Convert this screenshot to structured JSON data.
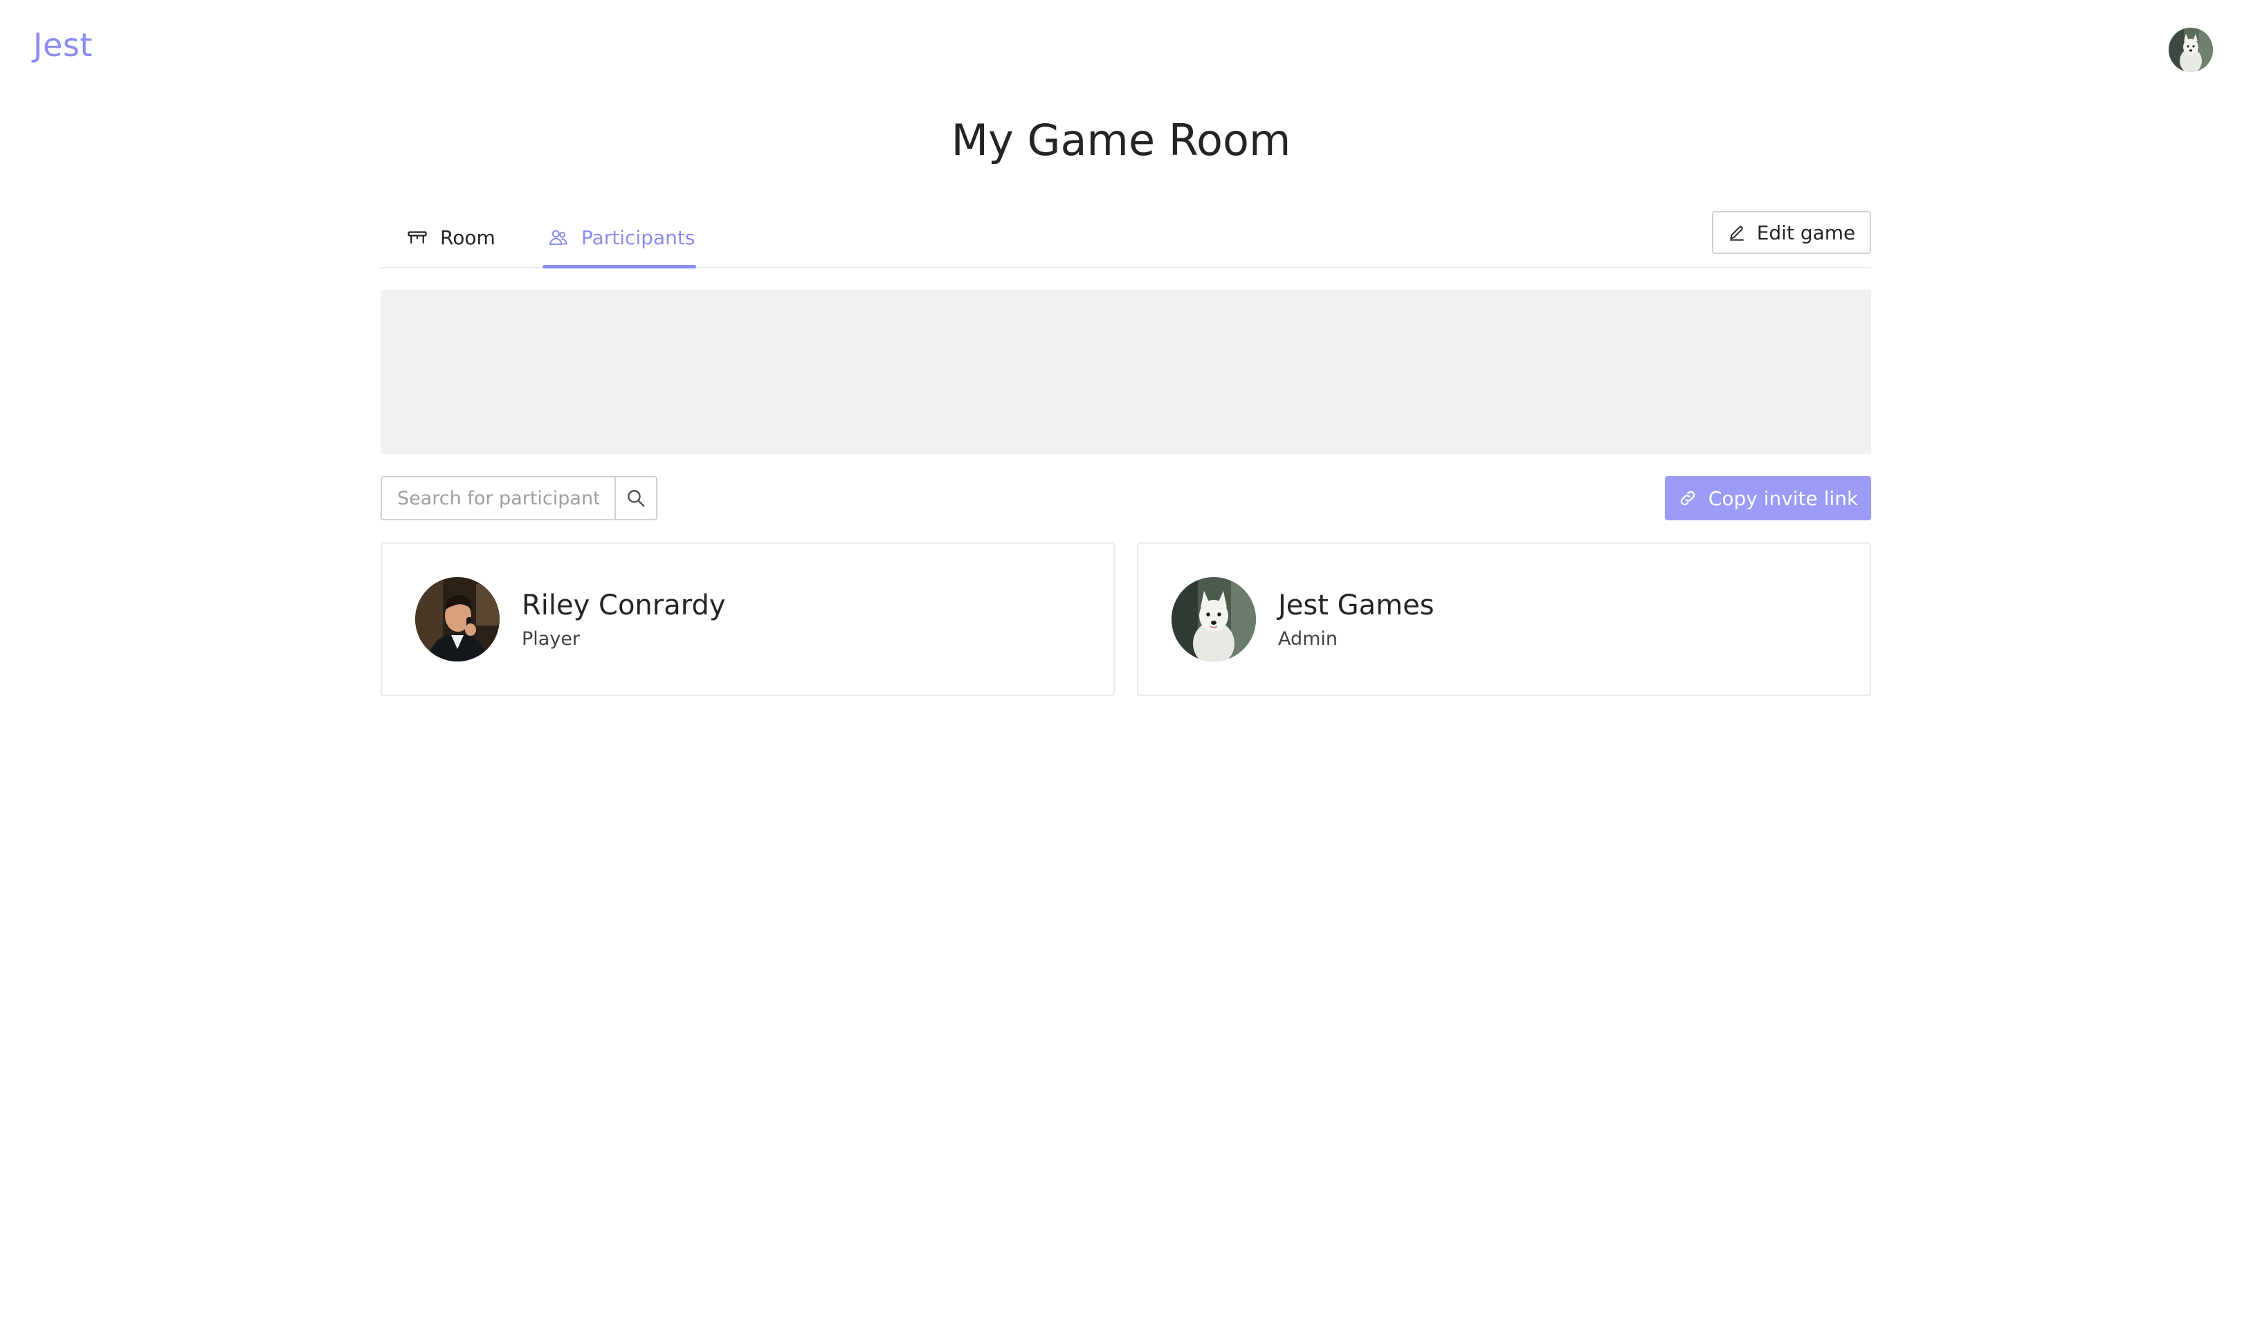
{
  "app": {
    "logo": "Jest"
  },
  "header": {
    "title": "My Game Room"
  },
  "tabs": [
    {
      "label": "Room",
      "icon": "table-icon",
      "active": false
    },
    {
      "label": "Participants",
      "icon": "people-icon",
      "active": true
    }
  ],
  "actions": {
    "edit_label": "Edit game",
    "copy_invite_label": "Copy invite link"
  },
  "search": {
    "placeholder": "Search for participant",
    "value": ""
  },
  "participants": [
    {
      "name": "Riley Conrardy",
      "role": "Player",
      "avatar": "man-phone-avatar"
    },
    {
      "name": "Jest Games",
      "role": "Admin",
      "avatar": "white-dog-avatar"
    }
  ],
  "colors": {
    "accent": "#8b8cf0",
    "button": "#9b9cf7",
    "banner": "#f1f1f1"
  }
}
